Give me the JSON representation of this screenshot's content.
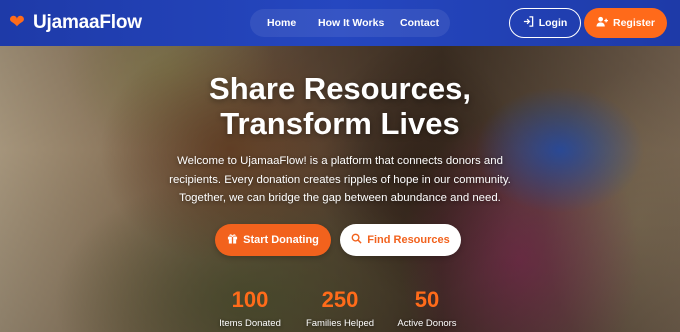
{
  "brand": {
    "name": "UjamaaFlow",
    "icon": "heart-icon",
    "accent": "#ff6b1a"
  },
  "nav": {
    "home": "Home",
    "how_it_works": "How It Works",
    "contact": "Contact"
  },
  "auth": {
    "login": "Login",
    "register": "Register",
    "login_icon": "login-arrow-icon",
    "register_icon": "user-plus-icon"
  },
  "hero": {
    "title_line1": "Share Resources,",
    "title_line2": "Transform Lives",
    "subtitle": "Welcome to UjamaaFlow! is a platform that connects donors and recipients. Every donation creates ripples of hope in our community. Together, we can bridge the gap between abundance and need.",
    "cta_primary": "Start Donating",
    "cta_primary_icon": "gift-icon",
    "cta_secondary": "Find Resources",
    "cta_secondary_icon": "search-icon"
  },
  "stats": [
    {
      "value": "100",
      "label": "Items Donated"
    },
    {
      "value": "250",
      "label": "Families Helped"
    },
    {
      "value": "50",
      "label": "Active Donors"
    }
  ],
  "colors": {
    "navbar": "#2547c0",
    "primary": "#f2621d",
    "text_on_dark": "#ffffff"
  }
}
